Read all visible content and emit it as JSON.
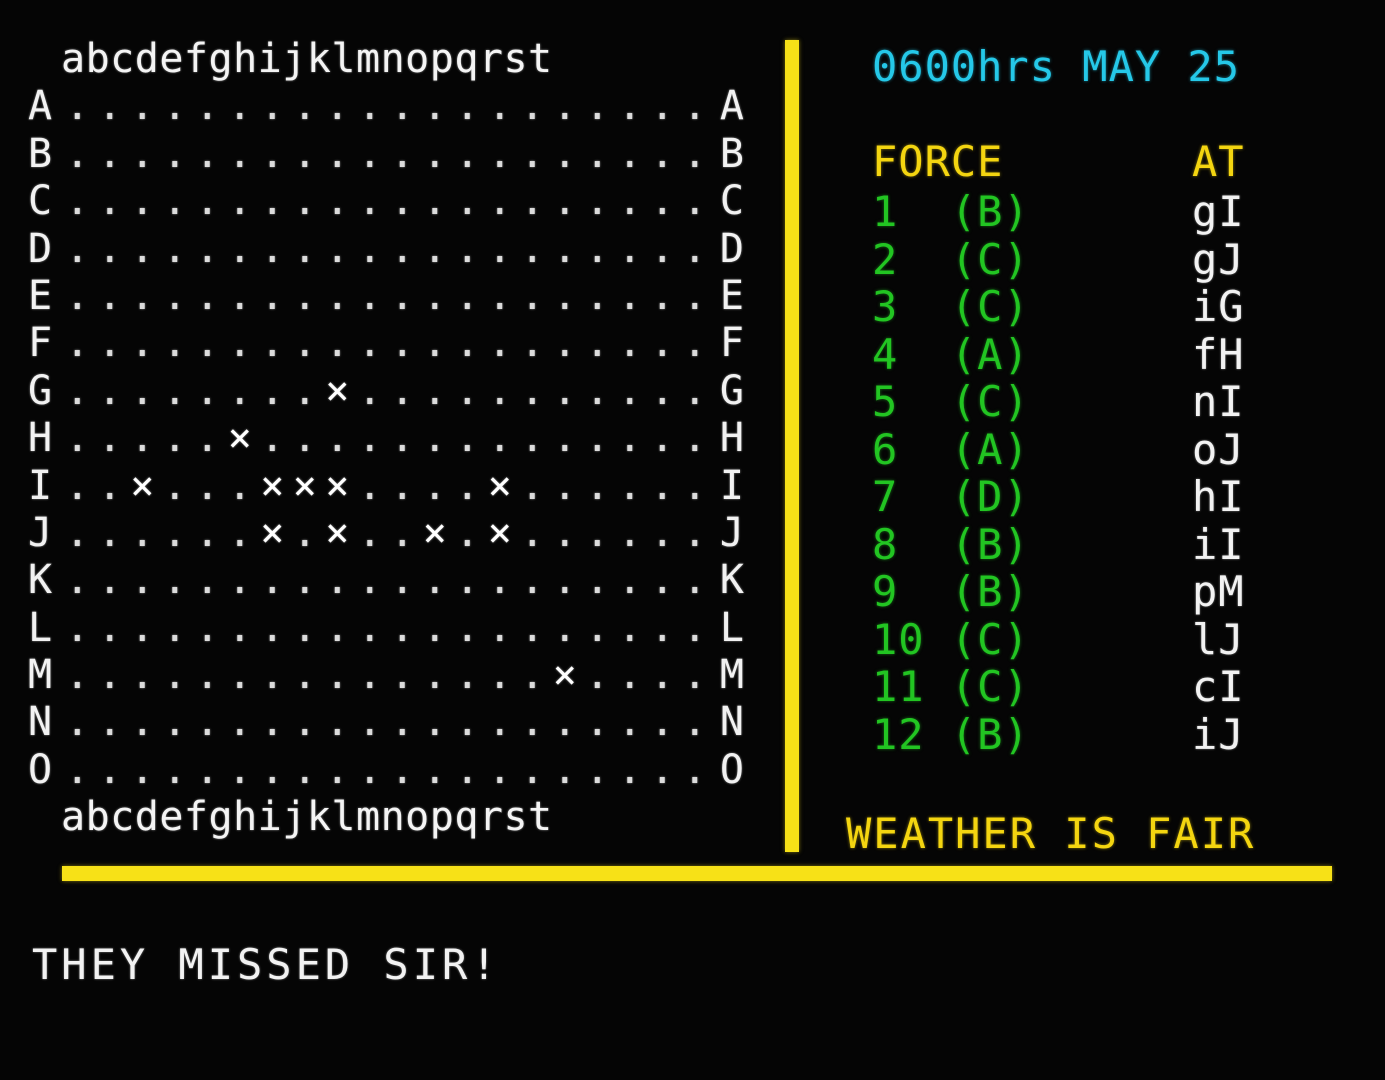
{
  "screen": {
    "background_color": "#000000",
    "accent_yellow": "#f7e117",
    "accent_cyan": "#25c8e8",
    "accent_green": "#22c522",
    "text_white": "#f2f2f2"
  },
  "map": {
    "column_header": "abcdefghijklmnopqrst",
    "column_footer": "abcdefghijklmnopqrst",
    "columns": [
      "a",
      "b",
      "c",
      "d",
      "e",
      "f",
      "g",
      "h",
      "i",
      "j",
      "k",
      "l",
      "m",
      "n",
      "o",
      "p",
      "q",
      "r",
      "s",
      "t"
    ],
    "row_labels": [
      "A",
      "B",
      "C",
      "D",
      "E",
      "F",
      "G",
      "H",
      "I",
      "J",
      "K",
      "L",
      "M",
      "N",
      "O"
    ],
    "empty_glyph": ".",
    "hit_glyph": "×",
    "rows": [
      {
        "label": "A",
        "cells": [
          ".",
          ".",
          ".",
          ".",
          ".",
          ".",
          ".",
          ".",
          ".",
          ".",
          ".",
          ".",
          ".",
          ".",
          ".",
          ".",
          ".",
          ".",
          ".",
          "."
        ]
      },
      {
        "label": "B",
        "cells": [
          ".",
          ".",
          ".",
          ".",
          ".",
          ".",
          ".",
          ".",
          ".",
          ".",
          ".",
          ".",
          ".",
          ".",
          ".",
          ".",
          ".",
          ".",
          ".",
          "."
        ]
      },
      {
        "label": "C",
        "cells": [
          ".",
          ".",
          ".",
          ".",
          ".",
          ".",
          ".",
          ".",
          ".",
          ".",
          ".",
          ".",
          ".",
          ".",
          ".",
          ".",
          ".",
          ".",
          ".",
          "."
        ]
      },
      {
        "label": "D",
        "cells": [
          ".",
          ".",
          ".",
          ".",
          ".",
          ".",
          ".",
          ".",
          ".",
          ".",
          ".",
          ".",
          ".",
          ".",
          ".",
          ".",
          ".",
          ".",
          ".",
          "."
        ]
      },
      {
        "label": "E",
        "cells": [
          ".",
          ".",
          ".",
          ".",
          ".",
          ".",
          ".",
          ".",
          ".",
          ".",
          ".",
          ".",
          ".",
          ".",
          ".",
          ".",
          ".",
          ".",
          ".",
          "."
        ]
      },
      {
        "label": "F",
        "cells": [
          ".",
          ".",
          ".",
          ".",
          ".",
          ".",
          ".",
          ".",
          ".",
          ".",
          ".",
          ".",
          ".",
          ".",
          ".",
          ".",
          ".",
          ".",
          ".",
          "."
        ]
      },
      {
        "label": "G",
        "cells": [
          ".",
          ".",
          ".",
          ".",
          ".",
          ".",
          ".",
          ".",
          "×",
          ".",
          ".",
          ".",
          ".",
          ".",
          ".",
          ".",
          ".",
          ".",
          ".",
          "."
        ]
      },
      {
        "label": "H",
        "cells": [
          ".",
          ".",
          ".",
          ".",
          ".",
          "×",
          ".",
          ".",
          ".",
          ".",
          ".",
          ".",
          ".",
          ".",
          ".",
          ".",
          ".",
          ".",
          ".",
          "."
        ]
      },
      {
        "label": "I",
        "cells": [
          ".",
          ".",
          "×",
          ".",
          ".",
          ".",
          "×",
          "×",
          "×",
          ".",
          ".",
          ".",
          ".",
          "×",
          ".",
          ".",
          ".",
          ".",
          ".",
          "."
        ]
      },
      {
        "label": "J",
        "cells": [
          ".",
          ".",
          ".",
          ".",
          ".",
          ".",
          "×",
          ".",
          "×",
          ".",
          ".",
          "×",
          ".",
          "×",
          ".",
          ".",
          ".",
          ".",
          ".",
          "."
        ]
      },
      {
        "label": "K",
        "cells": [
          ".",
          ".",
          ".",
          ".",
          ".",
          ".",
          ".",
          ".",
          ".",
          ".",
          ".",
          ".",
          ".",
          ".",
          ".",
          ".",
          ".",
          ".",
          ".",
          "."
        ]
      },
      {
        "label": "L",
        "cells": [
          ".",
          ".",
          ".",
          ".",
          ".",
          ".",
          ".",
          ".",
          ".",
          ".",
          ".",
          ".",
          ".",
          ".",
          ".",
          ".",
          ".",
          ".",
          ".",
          "."
        ]
      },
      {
        "label": "M",
        "cells": [
          ".",
          ".",
          ".",
          ".",
          ".",
          ".",
          ".",
          ".",
          ".",
          ".",
          ".",
          ".",
          ".",
          ".",
          ".",
          "×",
          ".",
          ".",
          ".",
          "."
        ]
      },
      {
        "label": "N",
        "cells": [
          ".",
          ".",
          ".",
          ".",
          ".",
          ".",
          ".",
          ".",
          ".",
          ".",
          ".",
          ".",
          ".",
          ".",
          ".",
          ".",
          ".",
          ".",
          ".",
          "."
        ]
      },
      {
        "label": "O",
        "cells": [
          ".",
          ".",
          ".",
          ".",
          ".",
          ".",
          ".",
          ".",
          ".",
          ".",
          ".",
          ".",
          ".",
          ".",
          ".",
          ".",
          ".",
          ".",
          ".",
          "."
        ]
      }
    ]
  },
  "status": {
    "clock": "0600hrs MAY 25",
    "table": {
      "header_force": "FORCE",
      "header_at": "AT",
      "rows": [
        {
          "force": "1  (B)",
          "at": "gI"
        },
        {
          "force": "2  (C)",
          "at": "gJ"
        },
        {
          "force": "3  (C)",
          "at": "iG"
        },
        {
          "force": "4  (A)",
          "at": "fH"
        },
        {
          "force": "5  (C)",
          "at": "nI"
        },
        {
          "force": "6  (A)",
          "at": "oJ"
        },
        {
          "force": "7  (D)",
          "at": "hI"
        },
        {
          "force": "8  (B)",
          "at": "iI"
        },
        {
          "force": "9  (B)",
          "at": "pM"
        },
        {
          "force": "10 (C)",
          "at": "lJ"
        },
        {
          "force": "11 (C)",
          "at": "cI"
        },
        {
          "force": "12 (B)",
          "at": "iJ"
        }
      ]
    },
    "weather": "WEATHER IS FAIR"
  },
  "message": "THEY MISSED SIR!"
}
